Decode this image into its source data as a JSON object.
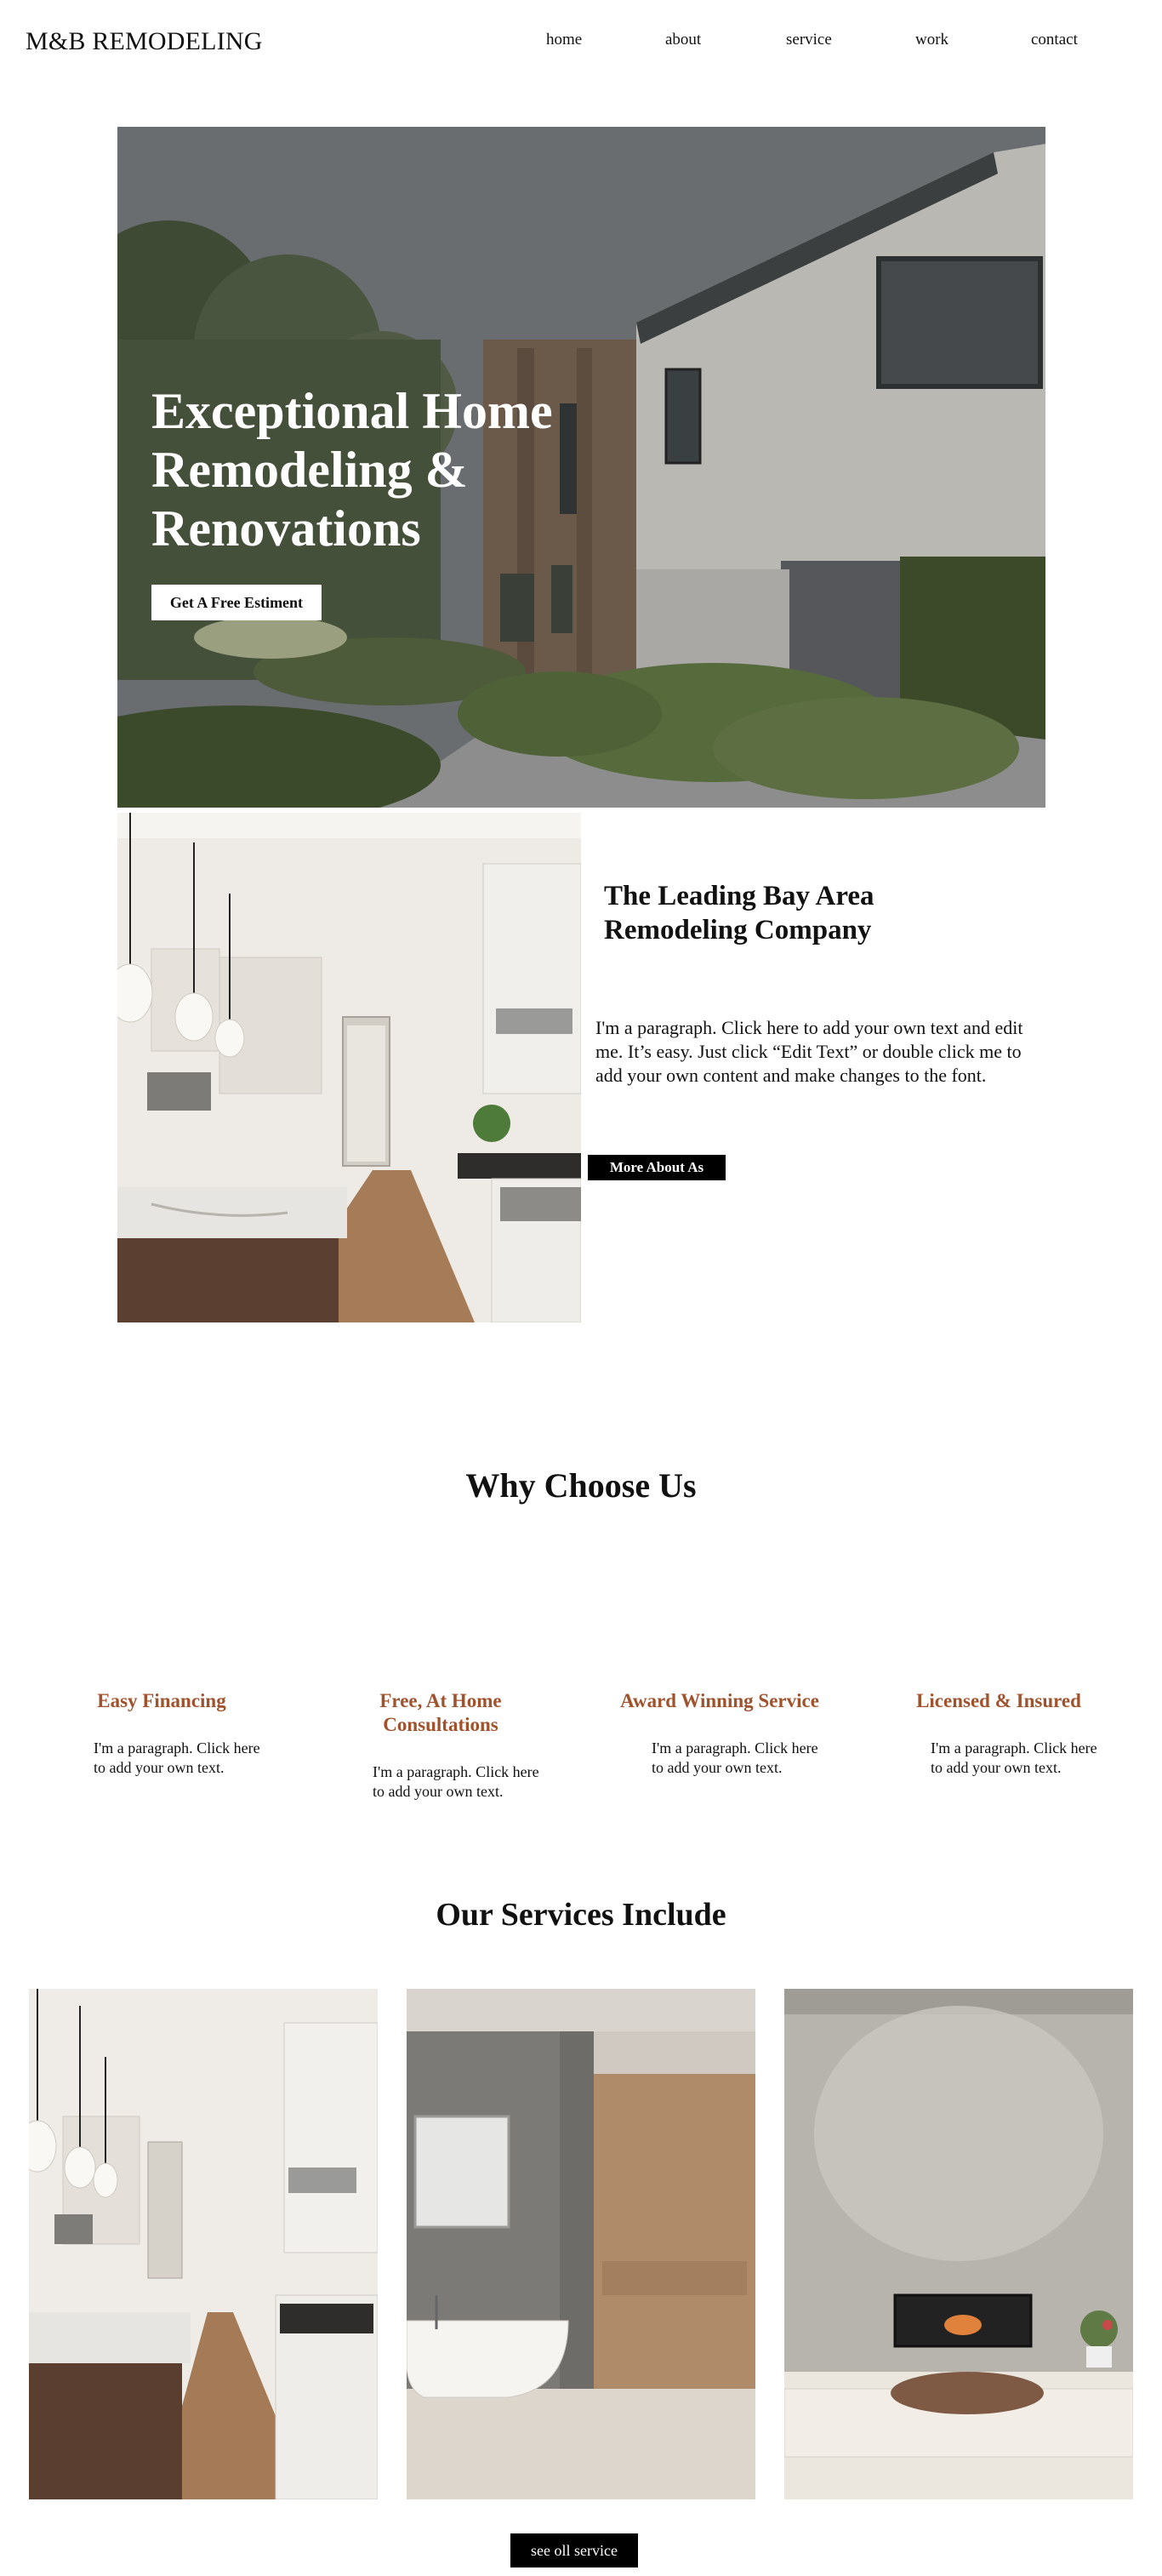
{
  "header": {
    "brand": "M&B REMODELING",
    "nav": [
      "home",
      "about",
      "service",
      "work",
      "contact"
    ]
  },
  "hero": {
    "title": "Exceptional Home Remodeling & Renovations",
    "cta": "Get A Free Estiment"
  },
  "about": {
    "title": "The Leading Bay Area Remodeling Company",
    "text": "I'm a paragraph. Click here to add your own text and edit me. It’s easy. Just click “Edit Text” or double click me to add your own content and make changes to the font.",
    "cta": "More About As"
  },
  "why": {
    "title": "Why Choose Us",
    "features": [
      {
        "title": "Easy Financing",
        "text": "I'm a paragraph. Click here to add your own text."
      },
      {
        "title": "Free, At Home Consultations",
        "text": "I'm a paragraph. Click here to add your own text."
      },
      {
        "title": "Award Winning Service",
        "text": "I'm a paragraph. Click here to add your own text."
      },
      {
        "title": "Licensed & Insured",
        "text": "I'm a paragraph. Click here to add your own text."
      }
    ]
  },
  "services": {
    "title": "Our Services Include",
    "cta": "see oll service"
  },
  "colors": {
    "accent": "#a0522d",
    "button_dark": "#000000"
  }
}
